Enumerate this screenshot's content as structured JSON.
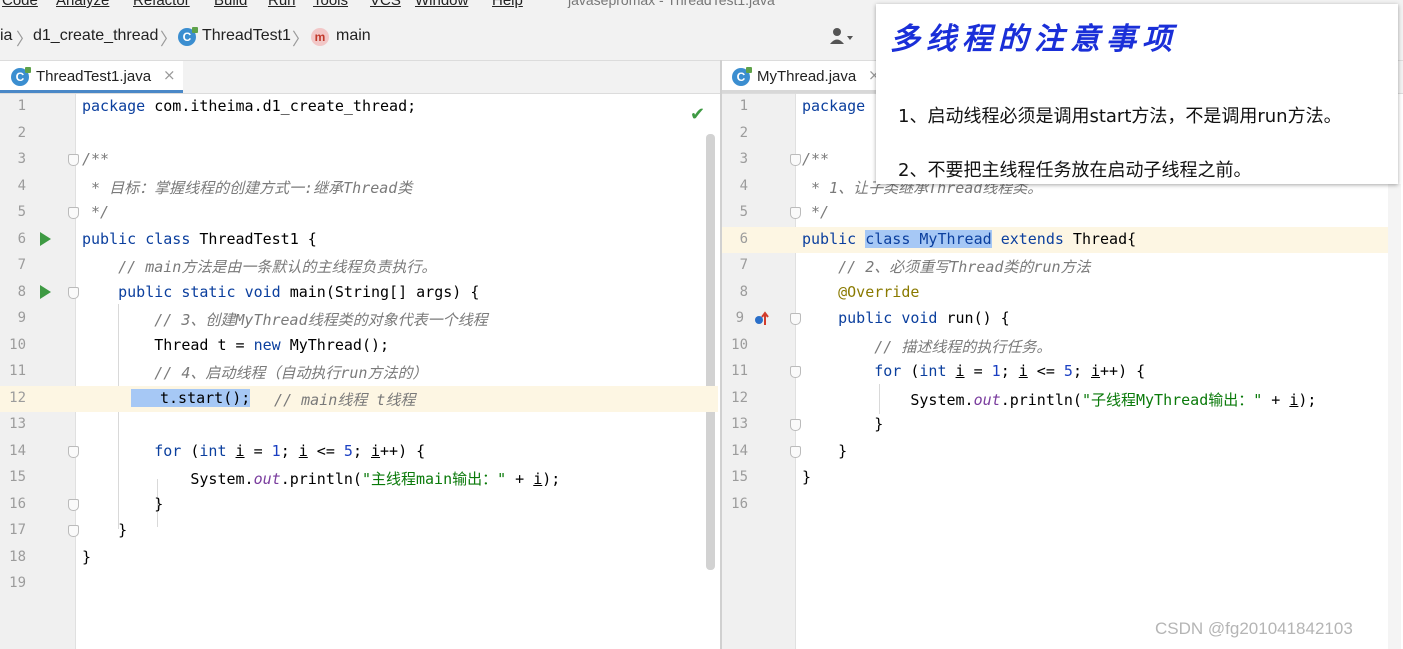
{
  "menu": [
    "Code",
    "Analyze",
    "Refactor",
    "Build",
    "Run",
    "Tools",
    "VCS",
    "Window",
    "Help"
  ],
  "window_title": "javasepromax - ThreadTest1.java",
  "breadcrumb": {
    "part0": "ia",
    "part1": "d1_create_thread",
    "part2": "ThreadTest1",
    "part3": "main",
    "class_icon": "C",
    "method_icon": "m"
  },
  "tabs": {
    "left": "ThreadTest1.java",
    "right": "MyThread.java",
    "close": "×"
  },
  "left_editor": {
    "line_numbers": [
      "1",
      "2",
      "3",
      "4",
      "5",
      "6",
      "7",
      "8",
      "9",
      "10",
      "11",
      "12",
      "13",
      "14",
      "15",
      "16",
      "17",
      "18",
      "19"
    ],
    "l1": [
      "package",
      " com.itheima.d1_create_thread;"
    ],
    "l3": "/**",
    "l4": " * 目标：掌握线程的创建方式一:继承Thread类",
    "l5": " */",
    "l6": [
      "public",
      " ",
      "class",
      " ThreadTest1 {"
    ],
    "l7": "    // main方法是由一条默认的主线程负责执行。",
    "l8": [
      "    ",
      "public",
      " ",
      "static",
      " ",
      "void",
      " main(String[] args) {"
    ],
    "l9": "        // 3、创建MyThread线程类的对象代表一个线程",
    "l10": [
      "        Thread t = ",
      "new",
      " MyThread();"
    ],
    "l11": "        // 4、启动线程（自动执行run方法的）",
    "l12": [
      "t.start();",
      "  // main线程 t线程"
    ],
    "l14": [
      "        ",
      "for",
      " (",
      "int",
      " ",
      "i",
      " = ",
      "1",
      "; ",
      "i",
      " <= ",
      "5",
      "; ",
      "i",
      "++) {"
    ],
    "l15": [
      "            System.",
      "out",
      ".println(",
      "\"主线程main输出：\"",
      " + ",
      "i",
      ");"
    ],
    "l16": "        }",
    "l17": "    }",
    "l18": "}"
  },
  "right_editor": {
    "line_numbers": [
      "1",
      "2",
      "3",
      "4",
      "5",
      "6",
      "7",
      "8",
      "9",
      "10",
      "11",
      "12",
      "13",
      "14",
      "15",
      "16"
    ],
    "l1": "package",
    "l3": "/**",
    "l4": " * 1、让子类继承Thread线程类。",
    "l5": " */",
    "l6": [
      "public",
      " ",
      "class MyThread",
      " ",
      "extends",
      " Thread{"
    ],
    "l7": "    // 2、必须重写Thread类的run方法",
    "l8": "    @Override",
    "l9": [
      "    ",
      "public",
      " ",
      "void",
      " run() {"
    ],
    "l10": "        // 描述线程的执行任务。",
    "l11": [
      "        ",
      "for",
      " (",
      "int",
      " ",
      "i",
      " = ",
      "1",
      "; ",
      "i",
      " <= ",
      "5",
      "; ",
      "i",
      "++) {"
    ],
    "l12": [
      "            System.",
      "out",
      ".println(",
      "\"子线程MyThread输出：\"",
      " + ",
      "i",
      ");"
    ],
    "l13": "        }",
    "l14": "    }",
    "l15": "}"
  },
  "overlay": {
    "title": "多线程的注意事项",
    "p1": "1、启动线程必须是调用start方法，不是调用run方法。",
    "p2": "2、不要把主线程任务放在启动子线程之前。"
  },
  "watermark": "CSDN @fg201041842103",
  "colors": {
    "keyword": "#0b3f9e",
    "comment": "#7a7a7a",
    "string": "#0a7a0a",
    "number": "#1a3fc2",
    "annotation": "#8a7a00",
    "selection": "#a6c8f5",
    "overlay_title": "#1a2fd8"
  },
  "icons": [
    "class-icon",
    "method-icon",
    "run-gutter-icon",
    "fold-icon",
    "check-icon",
    "user-icon",
    "override-gutter-icon"
  ]
}
